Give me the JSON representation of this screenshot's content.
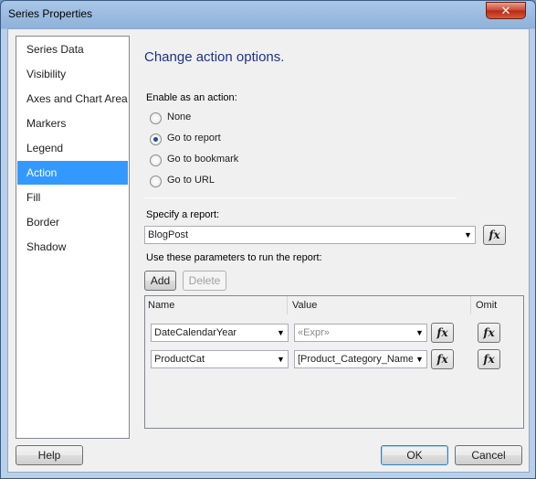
{
  "window": {
    "title": "Series Properties",
    "close_glyph": "✕"
  },
  "nav": {
    "items": [
      {
        "label": "Series Data"
      },
      {
        "label": "Visibility"
      },
      {
        "label": "Axes and Chart Area"
      },
      {
        "label": "Markers"
      },
      {
        "label": "Legend"
      },
      {
        "label": "Action",
        "selected": true
      },
      {
        "label": "Fill"
      },
      {
        "label": "Border"
      },
      {
        "label": "Shadow"
      }
    ]
  },
  "main": {
    "heading": "Change action options.",
    "enable_label": "Enable as an action:",
    "radios": [
      {
        "label": "None",
        "checked": false
      },
      {
        "label": "Go to report",
        "checked": true
      },
      {
        "label": "Go to bookmark",
        "checked": false
      },
      {
        "label": "Go to URL",
        "checked": false
      }
    ],
    "report_label": "Specify a report:",
    "report_value": "BlogPost",
    "params_label": "Use these parameters to run the report:",
    "add_label": "Add",
    "delete_label": "Delete",
    "fx_label": "fx",
    "dropdown_glyph": "▼",
    "columns": {
      "name": "Name",
      "value": "Value",
      "omit": "Omit"
    },
    "params": [
      {
        "name": "DateCalendarYear",
        "value": "«Expr»",
        "value_is_placeholder": true
      },
      {
        "name": "ProductCat",
        "value": "[Product_Category_Name]",
        "value_is_placeholder": false
      }
    ]
  },
  "footer": {
    "help_label": "Help",
    "ok_label": "OK",
    "cancel_label": "Cancel"
  }
}
